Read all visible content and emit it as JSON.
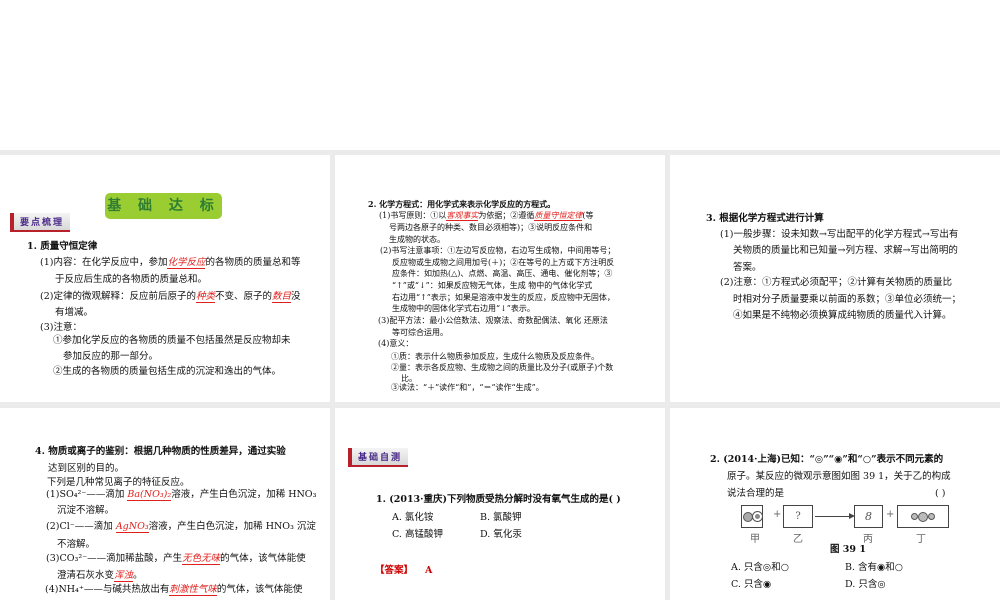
{
  "slide1": {
    "title": "基 础 达 标",
    "badge": "要点梳理",
    "l1": "1.  质量守恒定律",
    "l2a": "(1)内容：在化学反应中，参加",
    "l2r": "化学反应",
    "l2b": "的各物质的质量总和等",
    "l3": "于反应后生成的各物质的质量总和。",
    "l4a": "(2)定律的微观解释：反应前后原子的",
    "l4r": "种类",
    "l4b": "不变、原子的",
    "l4r2": "数目",
    "l4c": "没",
    "l5": "有增减。",
    "l6": "(3)注意：",
    "l7": "①参加化学反应的各物质的质量不包括虽然是反应物却未",
    "l8": "参加反应的那一部分。",
    "l9": "②生成的各物质的质量包括生成的沉淀和逸出的气体。"
  },
  "slide2": {
    "l1": "2.  化学方程式：用化学式来表示化学反应的方程式。",
    "l2a": "(1)书写原则：①以",
    "l2r": "客观事实",
    "l2b": "为依据；②遵循",
    "l2r2": "质量守恒定律",
    "l2c": "(等",
    "l3": "号两边各原子的种类、数目必须相等)；③说明反应条件和",
    "l4": "生成物的状态。",
    "l5": "(2)书写注意事项：①左边写反应物，右边写生成物，中间用等号；",
    "l6": "反应物或生成物之间用加号(＋)；②在等号的上方或下方注明反",
    "l7": "应条件：如加热(△)、点燃、高温、高压、通电、催化剂等；③",
    "l8": "“↑”或“↓”：如果反应物无气体，生成 物中的气体化学式",
    "l9": "右边用“↑”表示；如果是溶液中发生的反应，反应物中无固体，",
    "l10": "生成物中的固体化学式右边用“↓”表示。",
    "l11": "(3)配平方法：最小公倍数法、观察法、奇数配偶法、氧化 还原法",
    "l12": "等可综合运用。",
    "l13": "(4)意义：",
    "l14": "①质：表示什么物质参加反应，生成什么物质及反应条件。",
    "l15": "②量：表示各反应物、生成物之间的质量比及分子(或原子)个数",
    "l16": "比。",
    "l17": "③读法：“＋”读作“和”，“＝”读作“生成”。"
  },
  "slide3": {
    "l1": "3.  根据化学方程式进行计算",
    "l2": "(1)一般步骤：设未知数→写出配平的化学方程式→写出有",
    "l3": "关物质的质量比和已知量→列方程、求解→写出简明的",
    "l4": "答案。",
    "l5": "(2)注意：①方程式必须配平；②计算有关物质的质量比",
    "l6": "时相对分子质量要乘以前面的系数；③单位必须统一；",
    "l7": "④如果是不纯物必须换算成纯物质的质量代入计算。"
  },
  "slide4": {
    "l1": "4.  物质或离子的鉴别：根据几种物质的性质差异，通过实验",
    "l2": "达到区别的目的。",
    "l3": "下列是几种常见离子的特征反应。",
    "l4a": "(1)SO₄²⁻——滴加 ",
    "l4r": "Ba(NO₃)₂",
    "l4b": "溶液，产生白色沉淀，加稀 HNO₃",
    "l5": "沉淀不溶解。",
    "l6a": "(2)Cl⁻——滴加 ",
    "l6r": "AgNO₃",
    "l6b": "溶液，产生白色沉淀，加稀 HNO₃ 沉淀",
    "l7": "不溶解。",
    "l8a": "(3)CO₃²⁻——滴加稀盐酸，产生",
    "l8r": "无色无味",
    "l8b": "的气体，该气体能使",
    "l9a": "澄清石灰水变",
    "l9r": "浑浊",
    "l9b": "。",
    "l10a": "(4)NH₄⁺——与碱共热放出有",
    "l10r": "刺激性气味",
    "l10b": "的气体，该气体能使"
  },
  "slide5": {
    "badge": "基础自测",
    "q": "1.  (2013·重庆)下列物质受热分解时没有氧气生成的是(    )",
    "a": "A.  氯化铵",
    "b": "B.  氯酸钾",
    "c": "C.  高锰酸钾",
    "d": "D.  氧化汞",
    "ans_label": "【答案】",
    "ans": "A"
  },
  "slide6": {
    "l1": "2.  (2014·上海)已知：“◎”“◉”和“○”表示不同元素的",
    "l2": "原子。某反应的微观示意图如图  39 1，关于乙的构成",
    "l3": "说法合理的是",
    "paren": "(    )",
    "unknown": "?",
    "plus": "+",
    "labels": [
      "甲",
      "乙",
      "丙",
      "丁"
    ],
    "fig": "图 39 1",
    "a": "A.  只含◎和○",
    "b": "B.  含有◉和○",
    "c": "C.  只含◉",
    "d": "D.  只含◎"
  }
}
